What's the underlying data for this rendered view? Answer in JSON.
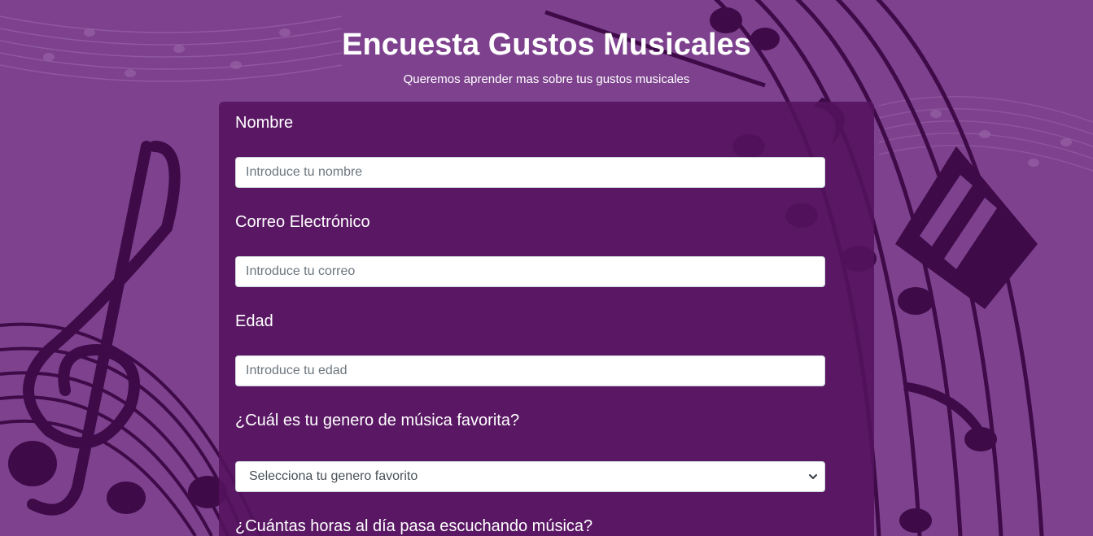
{
  "header": {
    "title": "Encuesta Gustos Musicales",
    "subtitle": "Queremos aprender mas sobre tus gustos musicales"
  },
  "form": {
    "name_label": "Nombre",
    "name_placeholder": "Introduce tu nombre",
    "email_label": "Correo Electrónico",
    "email_placeholder": "Introduce tu correo",
    "age_label": "Edad",
    "age_placeholder": "Introduce tu edad",
    "genre_label": "¿Cuál es tu genero de música favorita?",
    "genre_selected": "Selecciona tu genero favorito",
    "hours_label": "¿Cuántas horas al día pasa escuchando música?"
  },
  "icons": {
    "background": "music-notes-background",
    "select_arrow": "chevron-down-icon"
  },
  "colors": {
    "background": "#7b3f8c",
    "card": "#55125f",
    "text": "#ffffff"
  }
}
